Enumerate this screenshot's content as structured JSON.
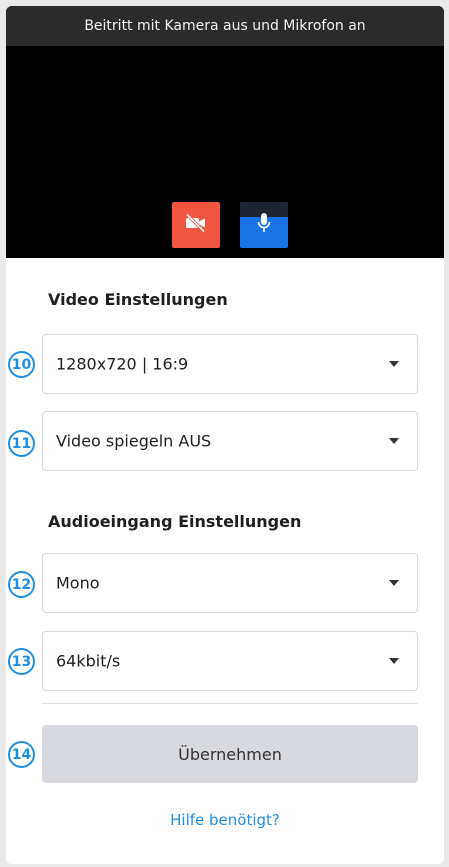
{
  "preview": {
    "title": "Beitritt mit Kamera aus und Mikrofon an",
    "camera_button_icon": "video-off-icon",
    "mic_button_icon": "microphone-icon",
    "colors": {
      "camera_off": "#f0563f",
      "mic_on": "#1a73e8"
    }
  },
  "video_settings": {
    "title": "Video Einstellungen",
    "resolution": {
      "badge": "10",
      "value": "1280x720 | 16:9"
    },
    "mirror": {
      "badge": "11",
      "value": "Video spiegeln AUS"
    }
  },
  "audio_settings": {
    "title": "Audioeingang Einstellungen",
    "channels": {
      "badge": "12",
      "value": "Mono"
    },
    "bitrate": {
      "badge": "13",
      "value": "64kbit/s"
    }
  },
  "actions": {
    "badge": "14",
    "apply_label": "Übernehmen",
    "help_link": "Hilfe benötigt?"
  }
}
